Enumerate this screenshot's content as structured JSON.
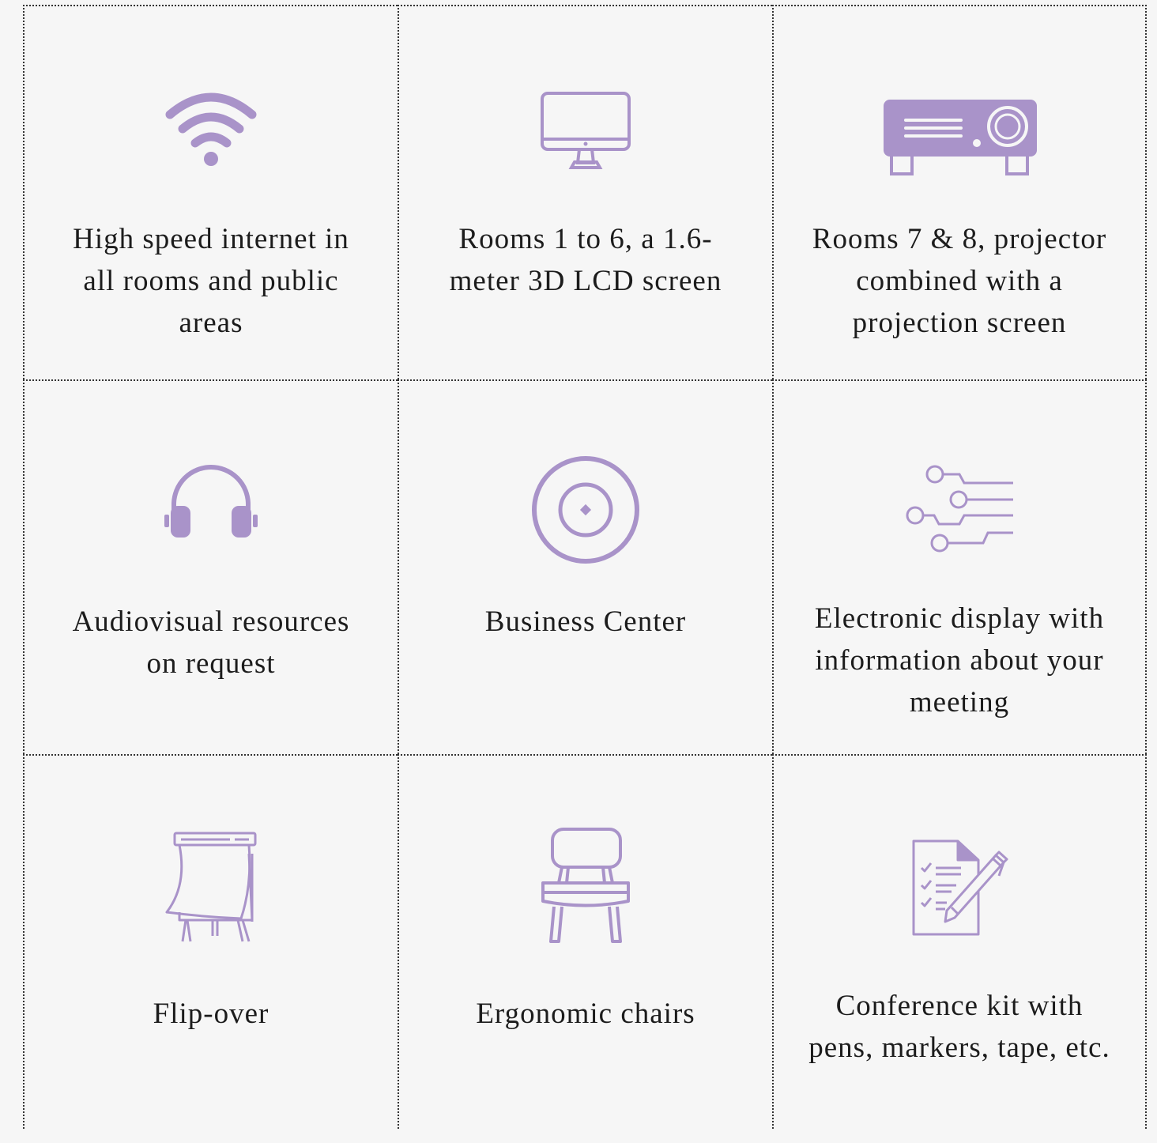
{
  "accent_color": "#a993c9",
  "features": [
    {
      "icon": "wifi-icon",
      "label": "High speed internet in all rooms and public areas"
    },
    {
      "icon": "monitor-icon",
      "label": "Rooms 1 to 6, a 1.6-meter 3D LCD screen"
    },
    {
      "icon": "projector-icon",
      "label": "Rooms 7 & 8, projector combined with a projection screen"
    },
    {
      "icon": "headphones-icon",
      "label": "Audiovisual resources on request"
    },
    {
      "icon": "target-icon",
      "label": "Business Center"
    },
    {
      "icon": "circuit-icon",
      "label": "Electronic display with information about your meeting"
    },
    {
      "icon": "flipchart-icon",
      "label": "Flip-over"
    },
    {
      "icon": "chair-icon",
      "label": "Ergonomic chairs"
    },
    {
      "icon": "checklist-pen-icon",
      "label": "Conference kit with pens, markers, tape, etc."
    }
  ]
}
